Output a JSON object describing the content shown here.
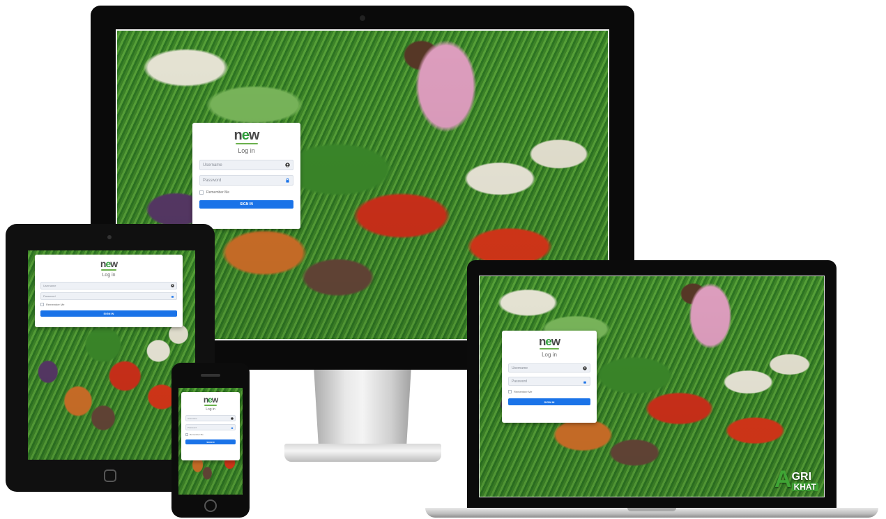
{
  "login": {
    "logo_prefix": "n",
    "logo_accent": "e",
    "logo_suffix": "w",
    "title": "Log in",
    "username_placeholder": "Username",
    "password_placeholder": "Password",
    "remember_label": "Remember Me",
    "signin_label": "SIGN IN"
  },
  "brand": {
    "agri_letter": "A",
    "agri_line1": "GRI",
    "agri_line2": "KHAT"
  },
  "colors": {
    "accent": "#1a73e8",
    "logo_green": "#2e9c3a",
    "brand_green": "#3fa535"
  },
  "icons": {
    "username_field": "user-icon",
    "password_field": "lock-icon"
  }
}
